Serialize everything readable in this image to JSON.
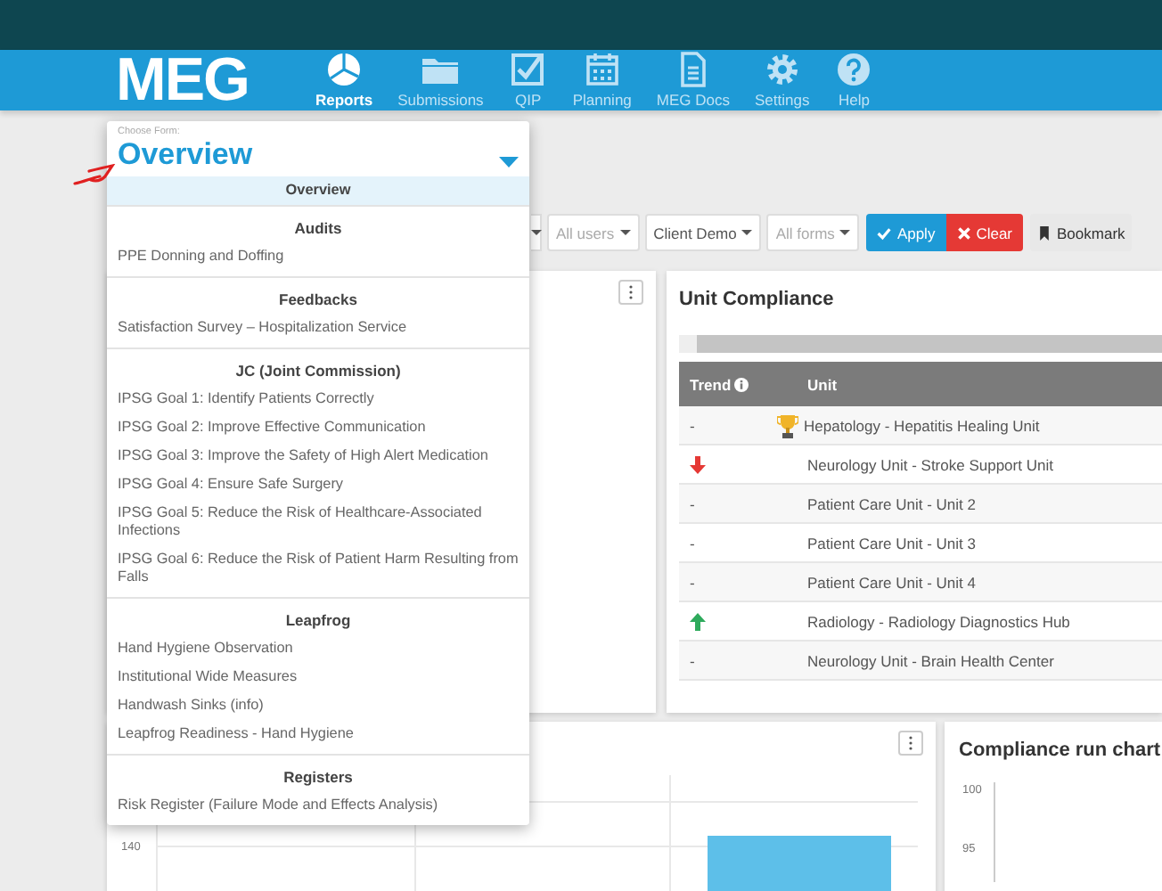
{
  "nav": {
    "logo": "MEG",
    "items": [
      {
        "kind": "pie",
        "label": "Reports",
        "selected": true
      },
      {
        "kind": "folder",
        "label": "Submissions",
        "selected": false
      },
      {
        "kind": "checkbox",
        "label": "QIP",
        "selected": false
      },
      {
        "kind": "calendar",
        "label": "Planning",
        "selected": false
      },
      {
        "kind": "document",
        "label": "MEG Docs",
        "selected": false
      },
      {
        "kind": "gear",
        "label": "Settings",
        "selected": false
      },
      {
        "kind": "help",
        "label": "Help",
        "selected": false
      }
    ]
  },
  "form_chooser": {
    "label": "Choose Form:",
    "value": "Overview",
    "expanded": true,
    "options": [
      {
        "label": "Overview",
        "selected": true
      }
    ],
    "groups": [
      {
        "title": "Audits",
        "items": [
          {
            "label": "PPE Donning and Doffing",
            "selected": false
          }
        ]
      },
      {
        "title": "Feedbacks",
        "items": [
          {
            "label": "Satisfaction Survey – Hospitalization Service",
            "selected": false
          }
        ]
      },
      {
        "title": "JC (Joint Commission)",
        "items": [
          {
            "label": "IPSG Goal 1: Identify Patients Correctly",
            "selected": false
          },
          {
            "label": "IPSG Goal 2: Improve Effective Communication",
            "selected": false
          },
          {
            "label": "IPSG Goal 3: Improve the Safety of High Alert Medication",
            "selected": false
          },
          {
            "label": "IPSG Goal 4: Ensure Safe Surgery",
            "selected": false
          },
          {
            "label": "IPSG Goal 5: Reduce the Risk of Healthcare-Associated Infections",
            "selected": false
          },
          {
            "label": "IPSG Goal 6: Reduce the Risk of Patient Harm Resulting from Falls",
            "selected": false
          }
        ]
      },
      {
        "title": "Leapfrog",
        "items": [
          {
            "label": "Hand Hygiene Observation",
            "selected": false
          },
          {
            "label": "Institutional Wide Measures",
            "selected": false
          },
          {
            "label": "Handwash Sinks (info)",
            "selected": false
          },
          {
            "label": "Leapfrog Readiness - Hand Hygiene",
            "selected": false
          }
        ]
      },
      {
        "title": "Registers",
        "items": [
          {
            "label": "Risk Register (Failure Mode and Effects Analysis)",
            "selected": false
          }
        ]
      }
    ]
  },
  "filters": [
    {
      "label": "All users",
      "dimmed": true
    },
    {
      "label": "Client Demo",
      "dimmed": false
    },
    {
      "label": "All forms",
      "dimmed": true
    }
  ],
  "actions": [
    {
      "kind": "apply",
      "label": "Apply"
    },
    {
      "kind": "clear",
      "label": "Clear"
    },
    {
      "kind": "bookmark",
      "label": "Bookmark"
    }
  ],
  "unit_compliance": {
    "title": "Unit Compliance",
    "columns": [
      "Trend",
      "Unit"
    ],
    "rows": [
      {
        "kind": "none",
        "trend_label": "-",
        "unit": "Hepatology - Hepatitis Healing Unit",
        "award": true
      },
      {
        "kind": "down",
        "unit": "Neurology Unit - Stroke Support Unit",
        "award": false
      },
      {
        "kind": "none",
        "trend_label": "-",
        "unit": "Patient Care Unit - Unit 2",
        "award": false
      },
      {
        "kind": "none",
        "trend_label": "-",
        "unit": "Patient Care Unit - Unit 3",
        "award": false
      },
      {
        "kind": "none",
        "trend_label": "-",
        "unit": "Patient Care Unit - Unit 4",
        "award": false
      },
      {
        "kind": "up",
        "unit": "Radiology - Radiology Diagnostics Hub",
        "award": false
      },
      {
        "kind": "none",
        "trend_label": "-",
        "unit": "Neurology Unit - Brain Health Center",
        "award": false
      }
    ]
  },
  "bar_chart": {
    "y_tick_labels": [
      "140"
    ]
  },
  "run_chart": {
    "title": "Compliance run chart",
    "y_tick_labels": [
      "100",
      "95"
    ]
  }
}
